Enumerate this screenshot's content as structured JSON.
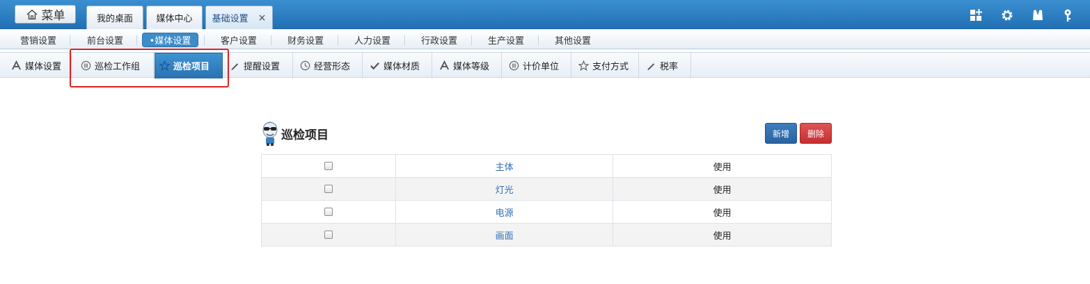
{
  "topbar": {
    "menu_label": "菜单",
    "menu_icon": "home-icon",
    "tabs": [
      {
        "label": "我的桌面"
      },
      {
        "label": "媒体中心"
      },
      {
        "label": "基础设置",
        "active": true,
        "close": "×"
      }
    ],
    "icons": [
      "grid-add-icon",
      "gear-icon",
      "shirt-icon",
      "key-icon"
    ]
  },
  "nav2": {
    "items": [
      {
        "label": "营销设置"
      },
      {
        "label": "前台设置"
      },
      {
        "label": "•媒体设置",
        "active": true
      },
      {
        "label": "客户设置"
      },
      {
        "label": "财务设置"
      },
      {
        "label": "人力设置"
      },
      {
        "label": "行政设置"
      },
      {
        "label": "生产设置"
      },
      {
        "label": "其他设置"
      }
    ]
  },
  "nav3": {
    "items": [
      {
        "label": "媒体设置",
        "icon": "letter-a-icon"
      },
      {
        "label": "巡检工作组",
        "icon": "pause-circle-icon"
      },
      {
        "label": "巡检项目",
        "icon": "star-icon",
        "active": true
      },
      {
        "label": "提醒设置",
        "icon": "pencil-icon"
      },
      {
        "label": "经营形态",
        "icon": "clock-icon"
      },
      {
        "label": "媒体材质",
        "icon": "check-icon"
      },
      {
        "label": "媒体等级",
        "icon": "letter-a-icon"
      },
      {
        "label": "计价单位",
        "icon": "pause-circle-icon"
      },
      {
        "label": "支付方式",
        "icon": "star-outline-icon"
      },
      {
        "label": "税率",
        "icon": "pencil-icon"
      }
    ]
  },
  "content": {
    "title": "巡检项目",
    "add_label": "新增",
    "delete_label": "删除",
    "rows": [
      {
        "name": "主体",
        "status": "使用"
      },
      {
        "name": "灯光",
        "status": "使用"
      },
      {
        "name": "电源",
        "status": "使用"
      },
      {
        "name": "画面",
        "status": "使用"
      }
    ]
  },
  "colors": {
    "header_blue": "#2a7bc0",
    "active_blue": "#3b8cc9",
    "highlight_red": "#e02020",
    "link_blue": "#2e6eb5",
    "delete_red": "#d04040"
  }
}
